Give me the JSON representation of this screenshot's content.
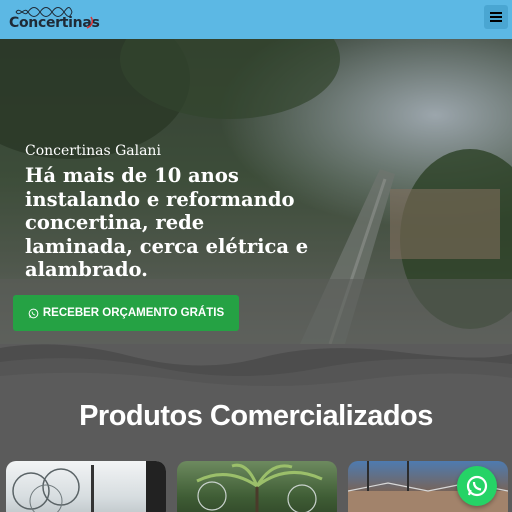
{
  "header": {
    "logo_text": "Concertinas",
    "menu_icon": "hamburger-menu-icon"
  },
  "hero": {
    "subtitle": "Concertinas Galani",
    "title": "Há mais de 10 anos instalando e reformando concertina, rede laminada, cerca elétrica e alambrado.",
    "cta_label": "RECEBER ORÇAMENTO GRÁTIS",
    "cta_icon": "whatsapp-icon"
  },
  "products": {
    "heading": "Produtos Comercializados",
    "cards": [
      "product-card-1",
      "product-card-2",
      "product-card-3"
    ]
  },
  "floating": {
    "icon": "whatsapp-icon"
  },
  "colors": {
    "header_bg": "#5cb8e4",
    "cta_bg": "#25a244",
    "whatsapp_green": "#25d366",
    "section_bg": "#5b5b5b"
  }
}
